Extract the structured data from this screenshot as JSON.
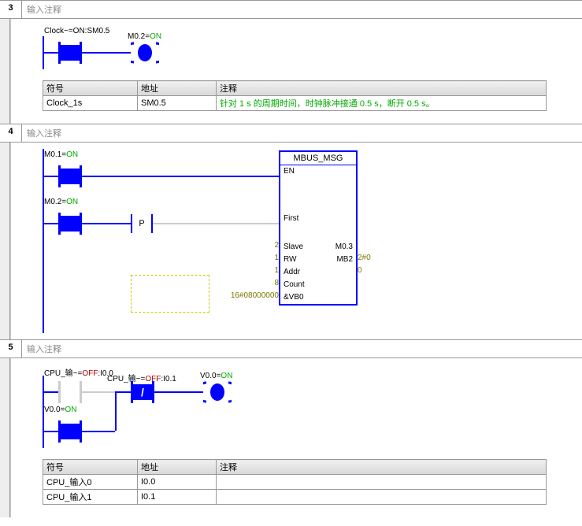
{
  "networks": [
    {
      "num": "3",
      "title": "输入注释",
      "rung1": {
        "contact1_label": "Clock~=ON:SM0.5",
        "coil_label_pre": "M0.2=",
        "coil_label_state": "ON"
      },
      "table": {
        "headers": [
          "符号",
          "地址",
          "注释"
        ],
        "rows": [
          [
            "Clock_1s",
            "SM0.5",
            "针对 1 s 的周期时间，时钟脉冲接通 0.5 s，断开 0.5 s。"
          ]
        ]
      }
    },
    {
      "num": "4",
      "title": "输入注释",
      "rung1": {
        "contact_label_pre": "M0.1=",
        "contact_label_state": "ON"
      },
      "rung2": {
        "contact_label_pre": "M0.2=",
        "contact_label_state": "ON",
        "p_label": "P"
      },
      "block": {
        "title": "MBUS_MSG",
        "pins_left": [
          {
            "name": "EN",
            "val": ""
          },
          {
            "name": "First",
            "val": ""
          },
          {
            "name": "Slave",
            "val": "2"
          },
          {
            "name": "RW",
            "val": "1"
          },
          {
            "name": "Addr",
            "val": "1"
          },
          {
            "name": "Count",
            "val": "8"
          },
          {
            "name": "&VB0",
            "val": "16#08000000"
          }
        ],
        "pins_right": [
          {
            "name": "M0.3",
            "val": "2#0"
          },
          {
            "name": "MB2",
            "val": "0"
          }
        ]
      }
    },
    {
      "num": "5",
      "title": "输入注释",
      "rung1": {
        "c1_pre": "CPU_输~=",
        "c1_state": "OFF",
        "c1_addr": ":I0.0",
        "c2_pre": "CPU_输~=",
        "c2_state": "OFF",
        "c2_addr": ":I0.1",
        "coil_pre": "V0.0=",
        "coil_state": "ON"
      },
      "rung2": {
        "c_pre": "V0.0=",
        "c_state": "ON"
      },
      "table": {
        "headers": [
          "符号",
          "地址",
          "注释"
        ],
        "rows": [
          [
            "CPU_输入0",
            "I0.0",
            ""
          ],
          [
            "CPU_输入1",
            "I0.1",
            ""
          ]
        ]
      }
    }
  ]
}
